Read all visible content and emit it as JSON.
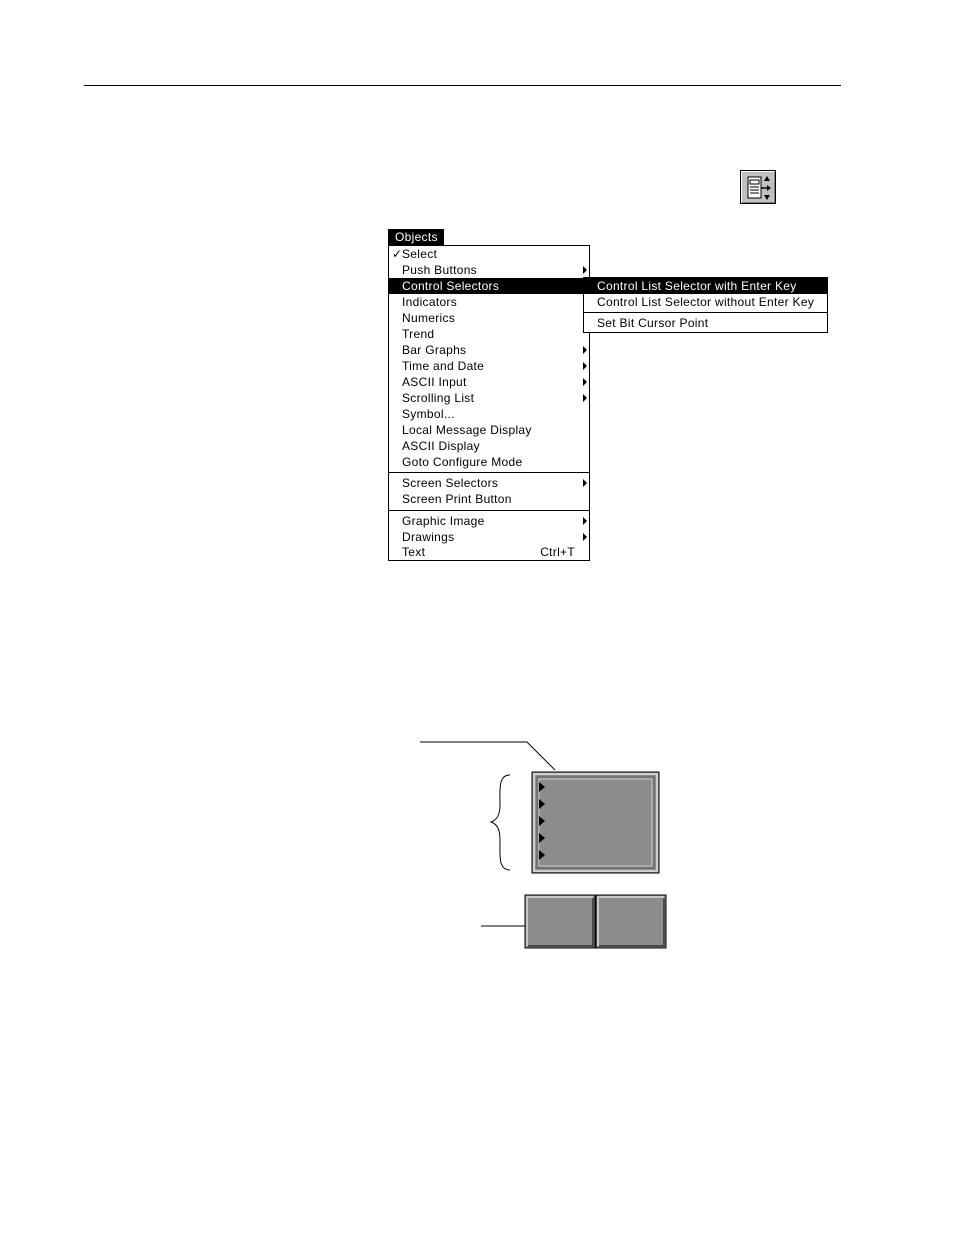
{
  "toolbar": {
    "icon": "control-list-selector-icon"
  },
  "menu": {
    "title": "Objects",
    "check_mark": "✓",
    "items": [
      {
        "label": "Select",
        "checked": true,
        "submenu": false
      },
      {
        "label": "Push Buttons",
        "submenu": true
      },
      {
        "label": "Control Selectors",
        "submenu": true,
        "highlighted": true
      },
      {
        "label": "Indicators",
        "submenu": false
      },
      {
        "label": "Numerics",
        "submenu": false
      },
      {
        "label": "Trend",
        "submenu": false
      },
      {
        "label": "Bar Graphs",
        "submenu": true
      },
      {
        "label": "Time and Date",
        "submenu": true
      },
      {
        "label": "ASCII Input",
        "submenu": true
      },
      {
        "label": "Scrolling List",
        "submenu": true
      },
      {
        "label": "Symbol...",
        "submenu": false
      },
      {
        "label": "Local Message Display",
        "submenu": false
      },
      {
        "label": "ASCII Display",
        "submenu": false
      },
      {
        "label": "Goto Configure Mode",
        "submenu": false
      },
      {
        "label": "Screen Selectors",
        "submenu": true
      },
      {
        "label": "Screen Print Button",
        "submenu": false
      },
      {
        "label": "Graphic Image",
        "submenu": true
      },
      {
        "label": "Drawings",
        "submenu": true
      },
      {
        "label": "Text",
        "submenu": false,
        "shortcut": "Ctrl+T"
      }
    ]
  },
  "submenu": {
    "items": [
      {
        "label": "Control List Selector with Enter Key",
        "highlighted": true
      },
      {
        "label": "Control List Selector without Enter Key"
      },
      {
        "label": "Set Bit Cursor Point"
      }
    ]
  },
  "colors": {
    "object_fill": "#8c8c8c",
    "highlight": "#000000"
  }
}
